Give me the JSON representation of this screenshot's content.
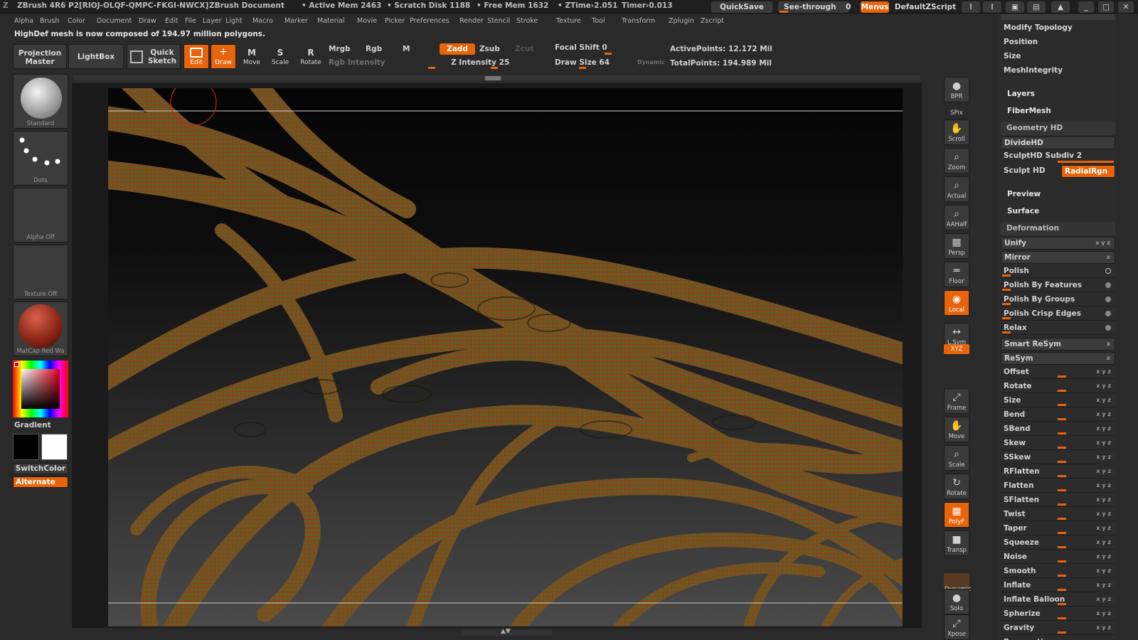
{
  "titlebar": {
    "app": "ZBrush 4R6 P2[RIOJ-OLQF-QMPC-FKGI-NWCX]",
    "document": "ZBrush Document",
    "active_mem": "• Active Mem 2463",
    "scratch_disk": "• Scratch Disk 1188",
    "free_mem": "• Free Mem 1632",
    "ztime": "• ZTime›2.051",
    "timer": "Timer›0.013",
    "quicksave": "QuickSave",
    "seethrough_label": "See-through",
    "seethrough_value": "0",
    "menus": "Menus",
    "defaultzscript": "DefaultZScript"
  },
  "menubar": [
    "Alpha",
    "Brush",
    "Color",
    "Document",
    "Draw",
    "Edit",
    "File",
    "Layer",
    "Light",
    "Macro",
    "Marker",
    "Material",
    "Movie",
    "Picker",
    "Preferences",
    "Render",
    "Stencil",
    "Stroke",
    "Texture",
    "Tool",
    "Transform",
    "Zplugin",
    "Zscript"
  ],
  "notice": "HighDef mesh is now composed of 194.97 million polygons.",
  "toolbar": {
    "projection_master": "Projection Master",
    "lightbox": "LightBox",
    "quick_sketch": "Quick Sketch",
    "edit": "Edit",
    "draw": "Draw",
    "move": "Move",
    "scale": "Scale",
    "rotate": "Rotate",
    "mrgb": "Mrgb",
    "rgb": "Rgb",
    "m": "M",
    "rgb_intensity": "Rgb Intensity",
    "zadd": "Zadd",
    "zsub": "Zsub",
    "zcut": "Zcut",
    "z_intensity": "Z Intensity 25",
    "focal_shift": "Focal Shift 0",
    "draw_size": "Draw Size 64",
    "dynamic": "Dynamic",
    "active_points": "ActivePoints: 12.172  Mil",
    "total_points": "TotalPoints: 194.989  Mil"
  },
  "leftshelf": {
    "brush": "Standard",
    "stroke": "Dots",
    "alpha": "Alpha  Off",
    "texture": "Texture  Off",
    "material": "MatCap Red Wa",
    "gradient": "Gradient",
    "switchcolor": "SwitchColor",
    "alternate": "Alternate"
  },
  "rightshelf": [
    {
      "name": "bpr",
      "label": "BPR",
      "glyph": "●"
    },
    {
      "name": "spix",
      "label": "SPix",
      "glyph": ""
    },
    {
      "name": "scroll",
      "label": "Scroll",
      "glyph": "✋"
    },
    {
      "name": "zoom",
      "label": "Zoom",
      "glyph": "⌕"
    },
    {
      "name": "actual",
      "label": "Actual",
      "glyph": "⌕"
    },
    {
      "name": "aahalf",
      "label": "AAHalf",
      "glyph": "⌕"
    },
    {
      "name": "persp",
      "label": "Persp",
      "glyph": "▦"
    },
    {
      "name": "floor",
      "label": "Floor",
      "glyph": "═"
    },
    {
      "name": "local",
      "label": "Local",
      "glyph": "◉"
    },
    {
      "name": "lsym",
      "label": "L.Sym",
      "glyph": "↔"
    },
    {
      "name": "xyz",
      "label": "XYZ",
      "glyph": ""
    },
    {
      "name": "frame",
      "label": "Frame",
      "glyph": "⤢"
    },
    {
      "name": "move",
      "label": "Move",
      "glyph": "✋"
    },
    {
      "name": "scale",
      "label": "Scale",
      "glyph": "⌕"
    },
    {
      "name": "rotate",
      "label": "Rotate",
      "glyph": "↻"
    },
    {
      "name": "polyf",
      "label": "PolyF",
      "glyph": "▦"
    },
    {
      "name": "transp",
      "label": "Transp",
      "glyph": "■"
    },
    {
      "name": "dynamic",
      "label": "Dynamic",
      "glyph": ""
    },
    {
      "name": "solo",
      "label": "Solo",
      "glyph": "●"
    },
    {
      "name": "xpose",
      "label": "Xpose",
      "glyph": "⤢"
    }
  ],
  "panel": {
    "modify_topology": "Modify Topology",
    "position": "Position",
    "size": "Size",
    "meshintegrity": "MeshIntegrity",
    "layers": "Layers",
    "fibermesh": "FiberMesh",
    "geometry_hd": "Geometry HD",
    "dividehd": "DivideHD",
    "sculpthd_subdiv": "SculptHD  Subdiv 2",
    "sculpt_hd": "Sculpt  HD",
    "radialrgn": "RadialRgn",
    "preview": "Preview",
    "surface": "Surface",
    "deformation": "Deformation",
    "items": [
      "Unify",
      "Mirror",
      "Polish",
      "Polish By Features",
      "Polish By Groups",
      "Polish Crisp Edges",
      "Relax",
      "Smart ReSym",
      "ReSym",
      "Offset",
      "Rotate",
      "Size",
      "Bend",
      "SBend",
      "Skew",
      "SSkew",
      "RFlatten",
      "Flatten",
      "SFlatten",
      "Twist",
      "Taper",
      "Squeeze",
      "Noise",
      "Smooth",
      "Inflate",
      "Inflate Balloon",
      "Spherize",
      "Gravity",
      "Perspective"
    ]
  },
  "colors": {
    "accent": "#e8640a",
    "bg": "#2a2a2a",
    "panel": "#3b3b3b"
  }
}
